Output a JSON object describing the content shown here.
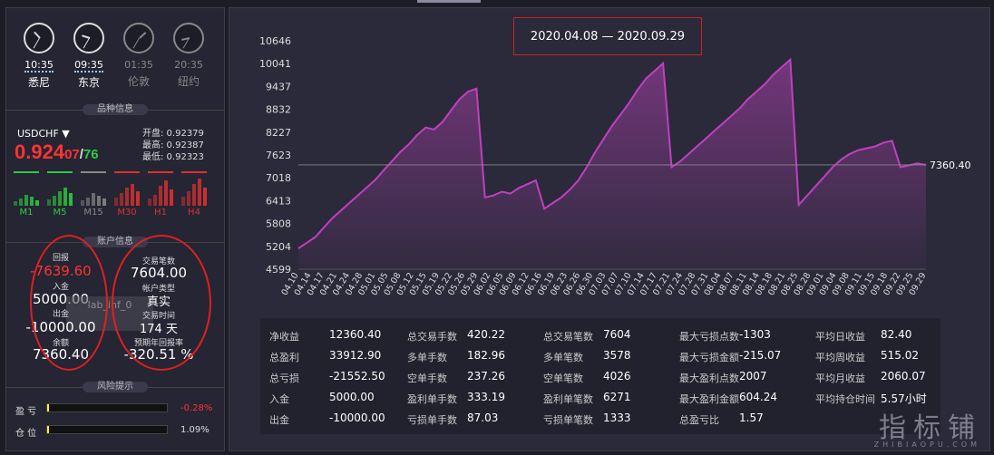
{
  "clocks": [
    {
      "time": "10:35",
      "city": "悉尼",
      "active": true
    },
    {
      "time": "09:35",
      "city": "东京",
      "active": true
    },
    {
      "time": "01:35",
      "city": "伦敦",
      "active": false
    },
    {
      "time": "20:35",
      "city": "纽约",
      "active": false
    }
  ],
  "sections": {
    "symbol_info": "品种信息",
    "account_info": "账户信息",
    "risk": "风险提示"
  },
  "symbol": {
    "name": "USDCHF",
    "price_main": "0.924",
    "price_sub": "07",
    "price_sep": "/",
    "price_tail": "76",
    "open": "开盘: 0.92379",
    "high": "最高: 0.92387",
    "low": "最低: 0.92323"
  },
  "timeframes": [
    {
      "label": "M1",
      "color": "#2ecc40"
    },
    {
      "label": "M5",
      "color": "#2ecc40"
    },
    {
      "label": "M15",
      "color": "#888888"
    },
    {
      "label": "M30",
      "color": "#e03030"
    },
    {
      "label": "H1",
      "color": "#e03030"
    },
    {
      "label": "H4",
      "color": "#e03030"
    }
  ],
  "account": {
    "drawdown_label": "回报",
    "drawdown": "-7639.60",
    "deposit_label": "入金",
    "deposit": "5000.00",
    "withdraw_label": "出金",
    "withdraw": "-10000.00",
    "balance_label": "余额",
    "balance": "7360.40",
    "trades_label": "交易笔数",
    "trades": "7604.00",
    "type_label": "帐户类型",
    "type": "真实",
    "time_label": "交易时间",
    "time": "174 天",
    "annual_label": "预期年回报率",
    "annual": "-320.51 %",
    "ghost": "lab_inf_0"
  },
  "risk": {
    "profit_label": "盈 亏",
    "profit": "-0.28%",
    "pos_label": "仓 位",
    "pos": "1.09%"
  },
  "date_range": "2020.04.08 — 2020.09.29",
  "chart_data": {
    "type": "area",
    "yticks": [
      "10646",
      "10041",
      "9437",
      "8832",
      "8227",
      "7623",
      "7018",
      "6413",
      "5808",
      "5204",
      "4599"
    ],
    "ylim": [
      4599,
      10646
    ],
    "xticks": [
      "04.10",
      "04.14",
      "04.17",
      "04.21",
      "04.24",
      "04.28",
      "05.01",
      "05.05",
      "05.08",
      "05.12",
      "05.15",
      "05.19",
      "05.22",
      "05.26",
      "05.29",
      "06.02",
      "06.05",
      "06.09",
      "06.12",
      "06.16",
      "06.19",
      "06.23",
      "06.26",
      "06.30",
      "07.03",
      "07.07",
      "07.10",
      "07.14",
      "07.17",
      "07.21",
      "07.24",
      "07.28",
      "07.31",
      "08.04",
      "08.07",
      "08.11",
      "08.14",
      "08.18",
      "08.21",
      "08.25",
      "08.28",
      "09.01",
      "09.04",
      "09.08",
      "09.11",
      "09.15",
      "09.18",
      "09.22",
      "09.25",
      "09.29"
    ],
    "last_value": "7360.40",
    "values": [
      5150,
      5300,
      5450,
      5700,
      5950,
      6150,
      6350,
      6550,
      6750,
      6950,
      7200,
      7450,
      7700,
      7900,
      8150,
      8350,
      8300,
      8500,
      8800,
      9100,
      9300,
      9380,
      6500,
      6550,
      6650,
      6600,
      6750,
      6850,
      6950,
      6200,
      6350,
      6500,
      6700,
      6950,
      7300,
      7700,
      8050,
      8400,
      8700,
      9000,
      9350,
      9650,
      9850,
      10050,
      7300,
      7450,
      7650,
      7850,
      8050,
      8250,
      8450,
      8650,
      8850,
      9100,
      9300,
      9500,
      9750,
      9950,
      10150,
      6300,
      6550,
      6800,
      7050,
      7300,
      7500,
      7650,
      7750,
      7800,
      7850,
      7950,
      8000,
      7300,
      7350,
      7400,
      7360
    ]
  },
  "stats": [
    [
      {
        "k": "净收益",
        "v": "12360.40"
      },
      {
        "k": "总盈利",
        "v": "33912.90"
      },
      {
        "k": "总亏损",
        "v": "-21552.50"
      },
      {
        "k": "入金",
        "v": "5000.00"
      },
      {
        "k": "出金",
        "v": "-10000.00"
      }
    ],
    [
      {
        "k": "总交易手数",
        "v": "420.22"
      },
      {
        "k": "多单手数",
        "v": "182.96"
      },
      {
        "k": "空单手数",
        "v": "237.26"
      },
      {
        "k": "盈利单手数",
        "v": "333.19"
      },
      {
        "k": "亏损单手数",
        "v": "87.03"
      }
    ],
    [
      {
        "k": "总交易笔数",
        "v": "7604"
      },
      {
        "k": "多单笔数",
        "v": "3578"
      },
      {
        "k": "空单笔数",
        "v": "4026"
      },
      {
        "k": "盈利单笔数",
        "v": "6271"
      },
      {
        "k": "亏损单笔数",
        "v": "1333"
      }
    ],
    [
      {
        "k": "最大亏损点数",
        "v": "-1303"
      },
      {
        "k": "最大亏损金额",
        "v": "-215.07"
      },
      {
        "k": "最大盈利点数",
        "v": "2007"
      },
      {
        "k": "最大盈利金额",
        "v": "604.24"
      },
      {
        "k": "总盈亏比",
        "v": "1.57"
      }
    ],
    [
      {
        "k": "平均日收益",
        "v": "82.40"
      },
      {
        "k": "平均周收益",
        "v": "515.02"
      },
      {
        "k": "平均月收益",
        "v": "2060.07"
      },
      {
        "k": "平均持仓时间",
        "v": "5.57小时"
      }
    ]
  ],
  "watermark": "指标铺",
  "watermark_sub": "ZHIBIAOPU.COM"
}
